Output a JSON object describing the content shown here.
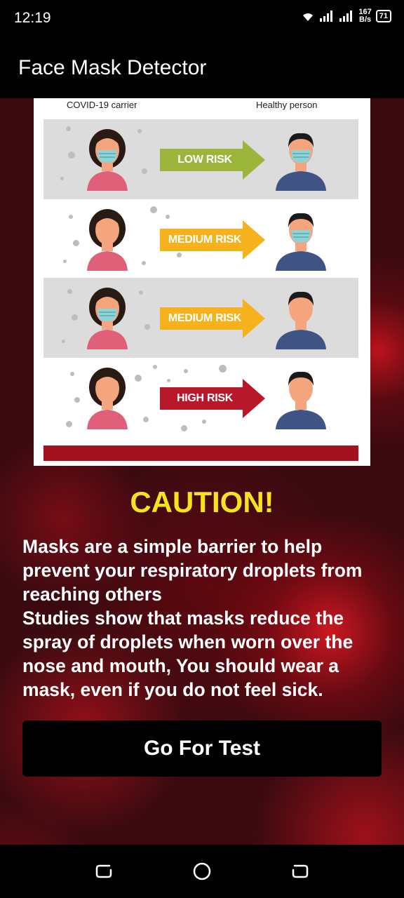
{
  "status_bar": {
    "time": "12:19",
    "net_speed_value": "167",
    "net_speed_unit": "B/s",
    "battery": "71",
    "icons": [
      "wifi-icon",
      "signal-icon",
      "signal-icon",
      "battery-icon"
    ]
  },
  "app_bar": {
    "title": "Face Mask Detector"
  },
  "infographic": {
    "left_caption": "COVID-19 carrier",
    "right_caption": "Healthy person",
    "rows": [
      {
        "risk": "LOW RISK",
        "color": "#9bb53a",
        "carrier_mask": true,
        "healthy_mask": true
      },
      {
        "risk": "MEDIUM RISK",
        "color": "#f5b21c",
        "carrier_mask": false,
        "healthy_mask": true
      },
      {
        "risk": "MEDIUM RISK",
        "color": "#f5b21c",
        "carrier_mask": true,
        "healthy_mask": false
      },
      {
        "risk": "HIGH RISK",
        "color": "#b7192a",
        "carrier_mask": false,
        "healthy_mask": false
      }
    ]
  },
  "caution": {
    "heading": "CAUTION!",
    "message": "Masks are a simple barrier to help prevent your respiratory droplets from reaching others\nStudies show that masks reduce the spray of droplets when worn over the nose and mouth, You should wear a mask, even if you do not feel sick."
  },
  "primary_action": {
    "label": "Go For Test"
  },
  "nav_bar": {
    "buttons": [
      "recents-icon",
      "home-icon",
      "back-icon"
    ]
  },
  "colors": {
    "accent_yellow": "#f6e31d",
    "background_red": "#3a0a10"
  }
}
